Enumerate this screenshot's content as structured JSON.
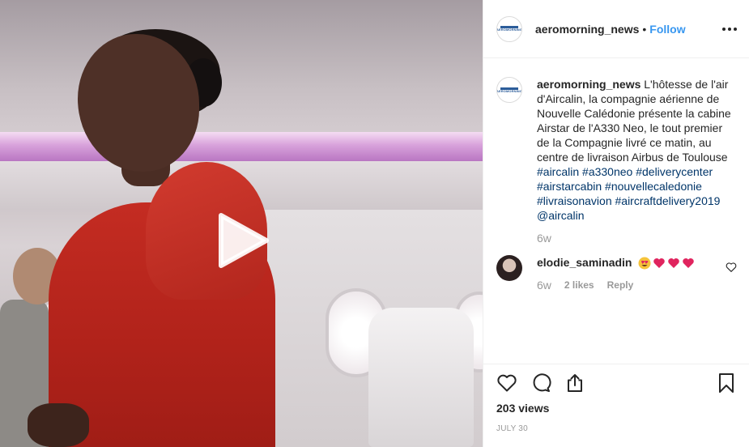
{
  "post": {
    "username": "aeromorning_news",
    "separator": "•",
    "follow_label": "Follow",
    "avatar_logo_text": "AEROMORNING"
  },
  "caption": {
    "username": "aeromorning_news",
    "text": "L'hôtesse de l'air d'Aircalin, la compagnie aérienne de Nouvelle Calédonie présente la cabine Airstar de l'A330 Neo, le tout premier de la Compagnie livré ce matin, au centre de livraison Airbus de Toulouse",
    "hashtags": "#aircalin #a330neo #deliverycenter #airstarcabin #nouvellecaledonie #livraisonavion #aircraftdelivery2019",
    "mention": "@aircalin",
    "age": "6w"
  },
  "comment": {
    "username": "elodie_saminadin",
    "emojis": [
      "heart-eyes-emoji",
      "red-heart-emoji",
      "red-heart-emoji",
      "red-heart-emoji"
    ],
    "age": "6w",
    "likes_label": "2 likes",
    "reply_label": "Reply"
  },
  "footer": {
    "views": "203 views",
    "date": "JULY 30"
  },
  "icons": {
    "play": "play-icon",
    "more": "more-options-icon",
    "like": "heart-icon",
    "comment": "comment-icon",
    "share": "share-icon",
    "save": "bookmark-icon"
  },
  "colors": {
    "link": "#3897f0",
    "hashtag": "#003569",
    "muted": "#999999",
    "heart_red": "#ed4956"
  }
}
